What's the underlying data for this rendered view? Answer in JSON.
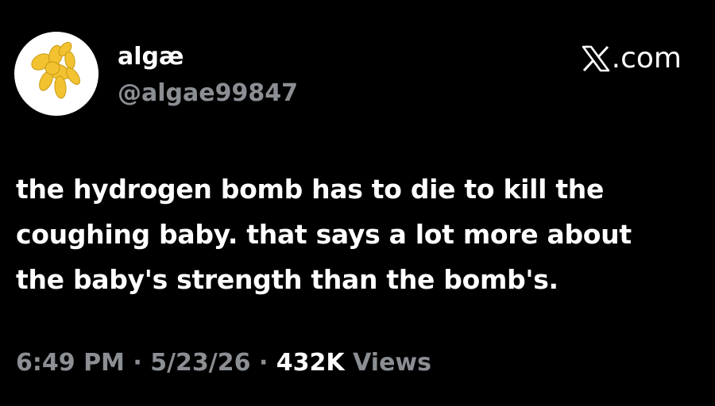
{
  "author": {
    "display_name": "algæ",
    "handle": "@algae99847",
    "avatar_icon": "yellow-balloon-dog-icon"
  },
  "site": {
    "logo_icon": "x-logo-icon",
    "label": ".com"
  },
  "tweet": {
    "lines": [
      "the hydrogen bomb has to die to kill the",
      "coughing baby. that says a lot more about",
      "the baby's strength than the bomb's."
    ]
  },
  "meta": {
    "time": "6:49 PM",
    "sep1": " · ",
    "date": "5/23/26",
    "sep2": " · ",
    "views_count": "432K",
    "views_label": " Views"
  },
  "colors": {
    "background": "#000000",
    "primary_text": "#ffffff",
    "secondary_text": "#8b8f94",
    "avatar_balloon": "#f2c230"
  }
}
